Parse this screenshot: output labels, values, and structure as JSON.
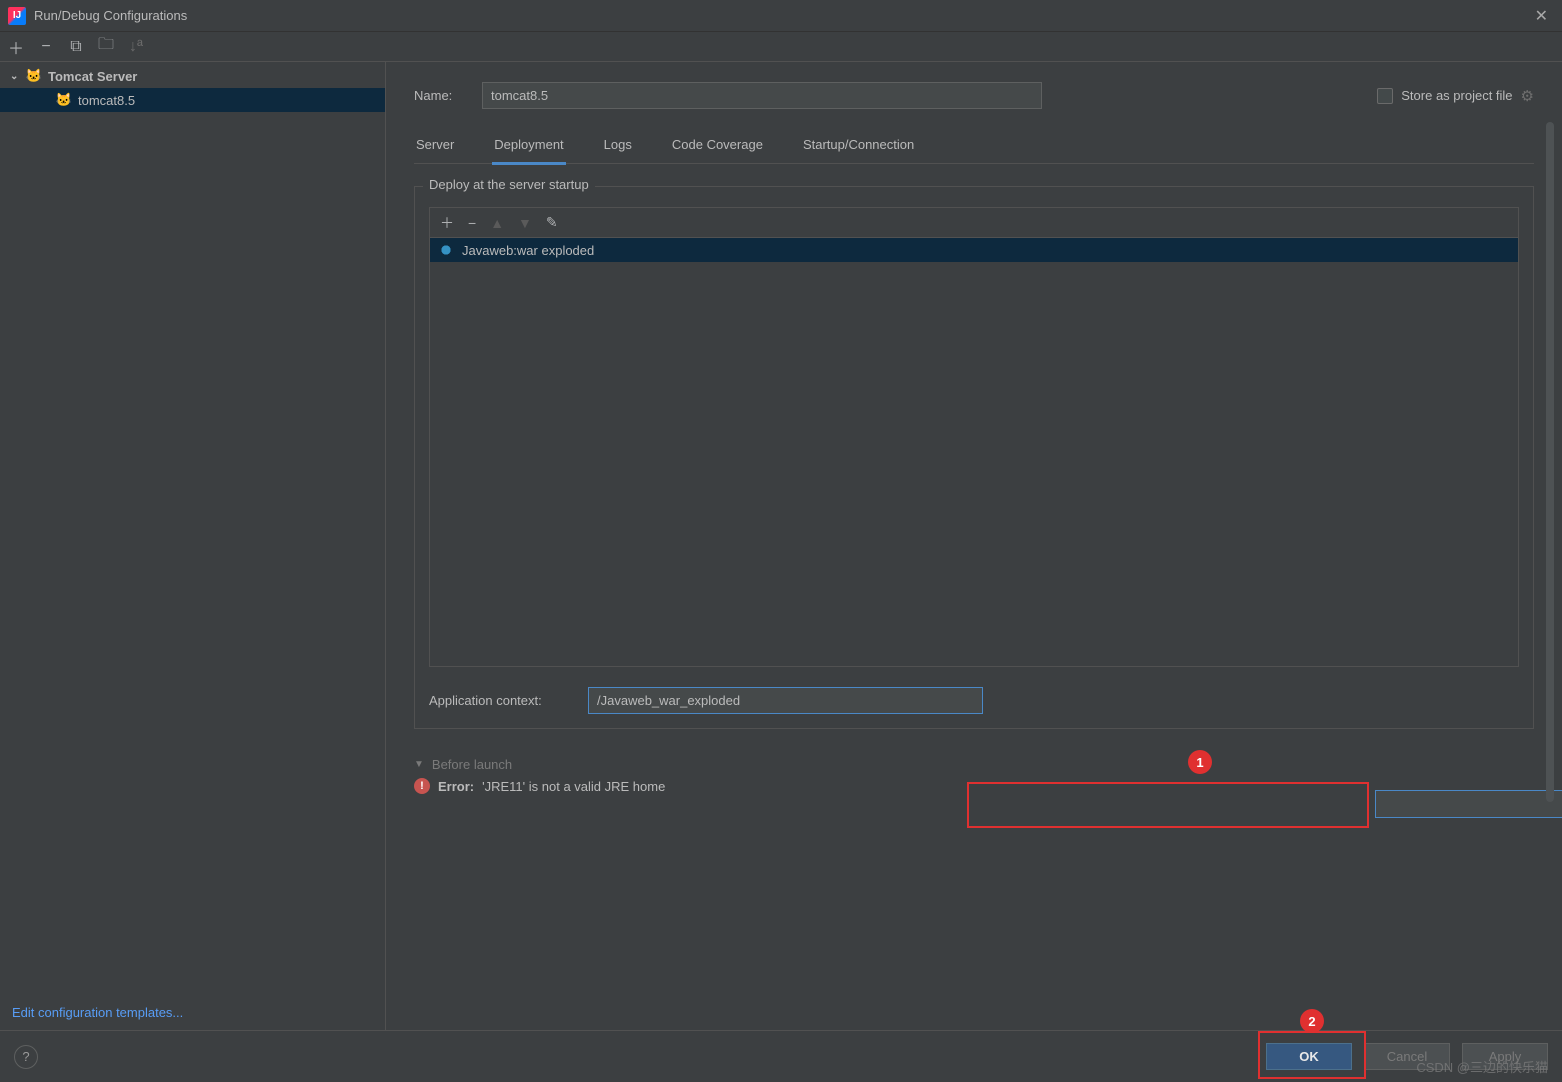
{
  "window": {
    "title": "Run/Debug Configurations"
  },
  "sidebar": {
    "group_label": "Tomcat Server",
    "items": [
      {
        "label": "tomcat8.5"
      }
    ],
    "edit_templates": "Edit configuration templates..."
  },
  "form": {
    "name_label": "Name:",
    "name_value": "tomcat8.5",
    "store_project": "Store as project file"
  },
  "tabs": {
    "server": "Server",
    "deployment": "Deployment",
    "logs": "Logs",
    "code_coverage": "Code Coverage",
    "startup": "Startup/Connection"
  },
  "deploy": {
    "legend": "Deploy at the server startup",
    "items": [
      {
        "label": "Javaweb:war exploded"
      }
    ],
    "context_label": "Application context:",
    "context_value": "/Javaweb_war_exploded"
  },
  "before_launch": "Before launch",
  "error": {
    "prefix": "Error:",
    "message": " 'JRE11' is not a valid JRE home"
  },
  "buttons": {
    "ok": "OK",
    "cancel": "Cancel",
    "apply": "Apply"
  },
  "callouts": {
    "one": "1",
    "two": "2"
  },
  "watermark": "CSDN @三边的快乐猫"
}
